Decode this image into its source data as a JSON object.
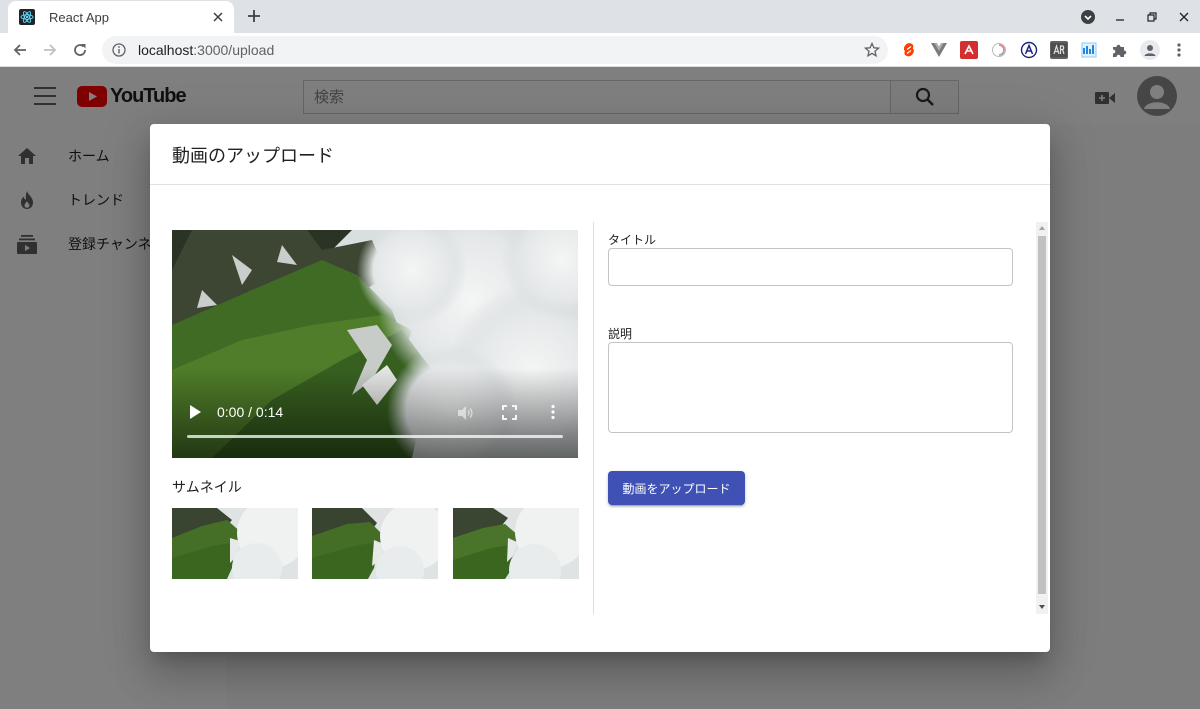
{
  "browser": {
    "tab_title": "React App",
    "tab_favicon_icon": "react-logo-icon",
    "url_host": "localhost",
    "url_path": ":3000/upload",
    "extensions": [
      "svelte-icon",
      "vue-devtools-icon",
      "redux-devtools-icon",
      "pinwheel-icon",
      "a-icon",
      "ar-icon",
      "tool-icon",
      "puzzle-icon"
    ]
  },
  "header": {
    "logo_text": "YouTube",
    "search_placeholder": "検索"
  },
  "sidebar": {
    "items": [
      {
        "label": "ホーム",
        "icon": "home-icon"
      },
      {
        "label": "トレンド",
        "icon": "flame-icon"
      },
      {
        "label": "登録チャンネル",
        "icon": "subscriptions-icon"
      }
    ]
  },
  "dialog": {
    "title": "動画のアップロード",
    "video_time": "0:00 / 0:14",
    "video_progress": 0,
    "thumbnails_label": "サムネイル",
    "title_label": "タイトル",
    "title_value": "",
    "description_label": "説明",
    "description_value": "",
    "upload_button_label": "動画をアップロード"
  },
  "colors": {
    "primary": "#3f51b5",
    "youtube_red": "#ff0000"
  }
}
